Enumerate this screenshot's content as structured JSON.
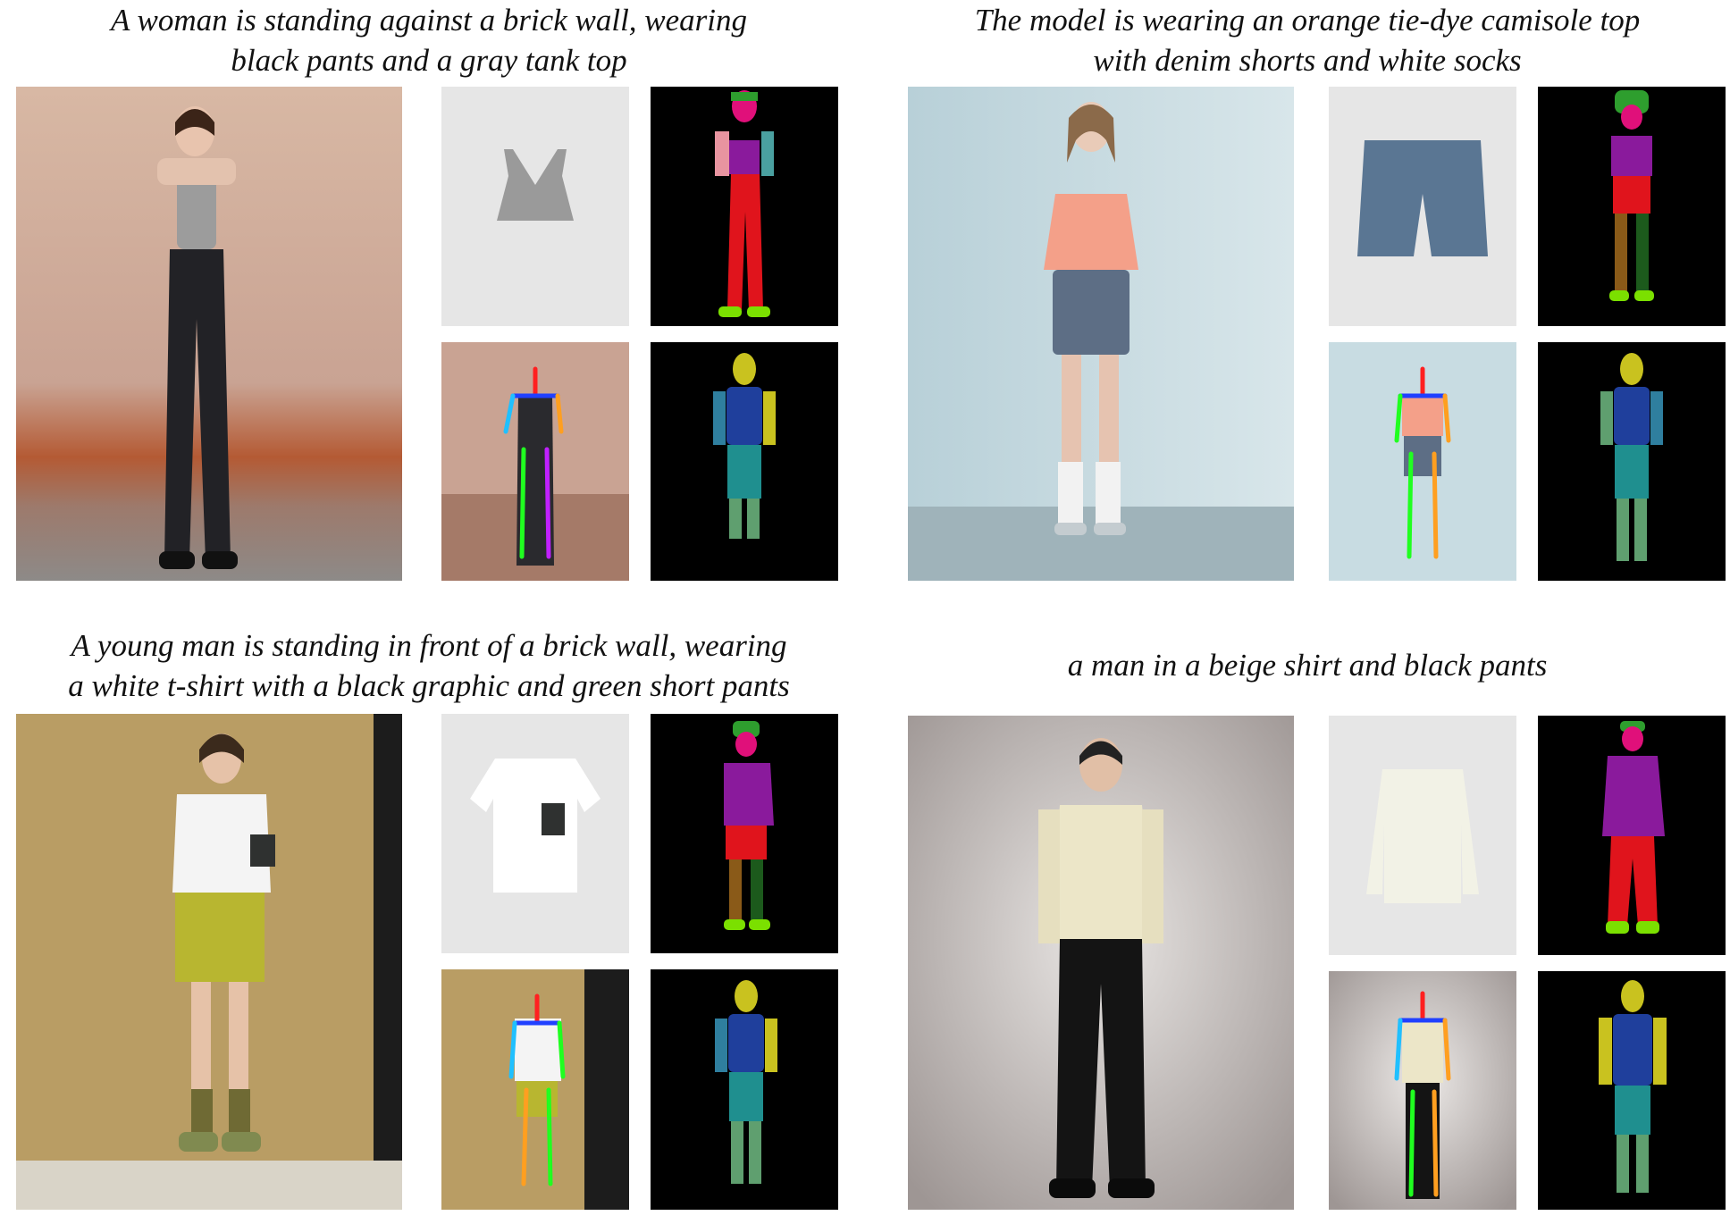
{
  "examples": [
    {
      "caption_line1": "A woman is standing against a brick wall, wearing",
      "caption_line2": "black pants and a gray tank top"
    },
    {
      "caption_line1": "The model is wearing an orange tie-dye camisole top",
      "caption_line2": "with denim shorts and white socks"
    },
    {
      "caption_line1": "A young man is standing in front of a brick wall, wearing",
      "caption_line2": "a white t-shirt with a black graphic and green short pants"
    },
    {
      "caption_line1": "a man in a beige shirt and black pants",
      "caption_line2": ""
    }
  ],
  "colors": {
    "background": "#ffffff",
    "garment_bg": "#e6e6e6",
    "mask_bg": "#000000",
    "parsing_face": "#e0107a",
    "parsing_hair": "#2e9e2e",
    "parsing_upper": "#8a1a9c",
    "parsing_lower": "#e0141c",
    "parsing_arm": "#4aa0a0",
    "parsing_shoe": "#7be000",
    "dense_head": "#c9c21f",
    "dense_torso": "#1f3f9c",
    "dense_arm": "#2f7f9f",
    "dense_leg": "#1f8f8f",
    "dense_lowerleg": "#5f9f6f",
    "pose_line_colors": [
      "#ff2020",
      "#ff9f20",
      "#20ff20",
      "#2040ff",
      "#20c0ff",
      "#c020ff"
    ]
  }
}
